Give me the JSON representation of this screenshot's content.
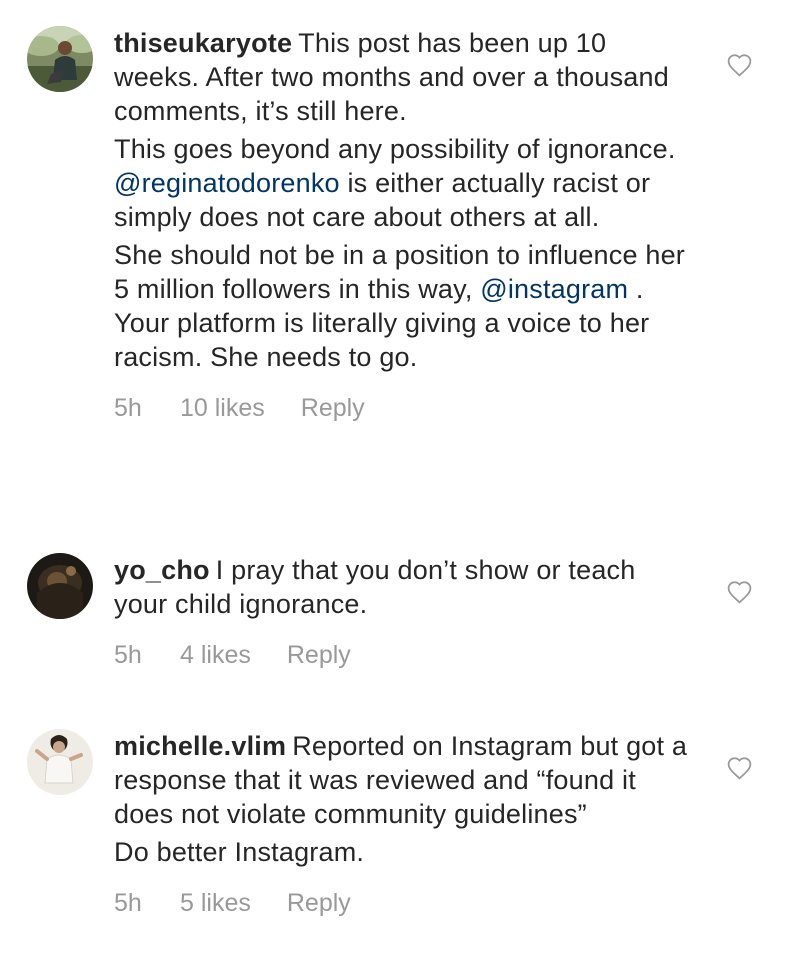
{
  "comments": [
    {
      "username": "thiseukaryote",
      "paragraphs": [
        [
          {
            "text": "This post has been up 10 weeks. After two months and over a thousand comments, it’s still here."
          }
        ],
        [
          {
            "text": "This goes beyond any possibility of ignorance. "
          },
          {
            "text": "@reginatodorenko",
            "mention": true
          },
          {
            "text": " is either actually racist or simply does not care about others at all."
          }
        ],
        [
          {
            "text": "She should not be in a position to influence her 5 million followers in this way, "
          },
          {
            "text": "@instagram",
            "mention": true
          },
          {
            "text": " . Your platform is literally giving a voice to her racism. She needs to go."
          }
        ]
      ],
      "time": "5h",
      "likes": "10 likes",
      "reply": "Reply",
      "avatar_icon": "profile-photo-man-outdoors",
      "like_icon": "heart-outline-icon"
    },
    {
      "username": "yo_cho",
      "paragraphs": [
        [
          {
            "text": "I pray that you don’t show or teach your child ignorance."
          }
        ]
      ],
      "time": "5h",
      "likes": "4 likes",
      "reply": "Reply",
      "avatar_icon": "profile-photo-dark",
      "like_icon": "heart-outline-icon"
    },
    {
      "username": "michelle.vlim",
      "paragraphs": [
        [
          {
            "text": "Reported on Instagram but got a response that it was reviewed and “found it does not violate community guidelines”"
          }
        ],
        [
          {
            "text": "Do better Instagram."
          }
        ]
      ],
      "time": "5h",
      "likes": "5 likes",
      "reply": "Reply",
      "avatar_icon": "profile-photo-woman",
      "like_icon": "heart-outline-icon"
    }
  ],
  "colors": {
    "text": "#262626",
    "mention": "#003569",
    "meta": "#999999",
    "heart_outline": "#999999"
  }
}
